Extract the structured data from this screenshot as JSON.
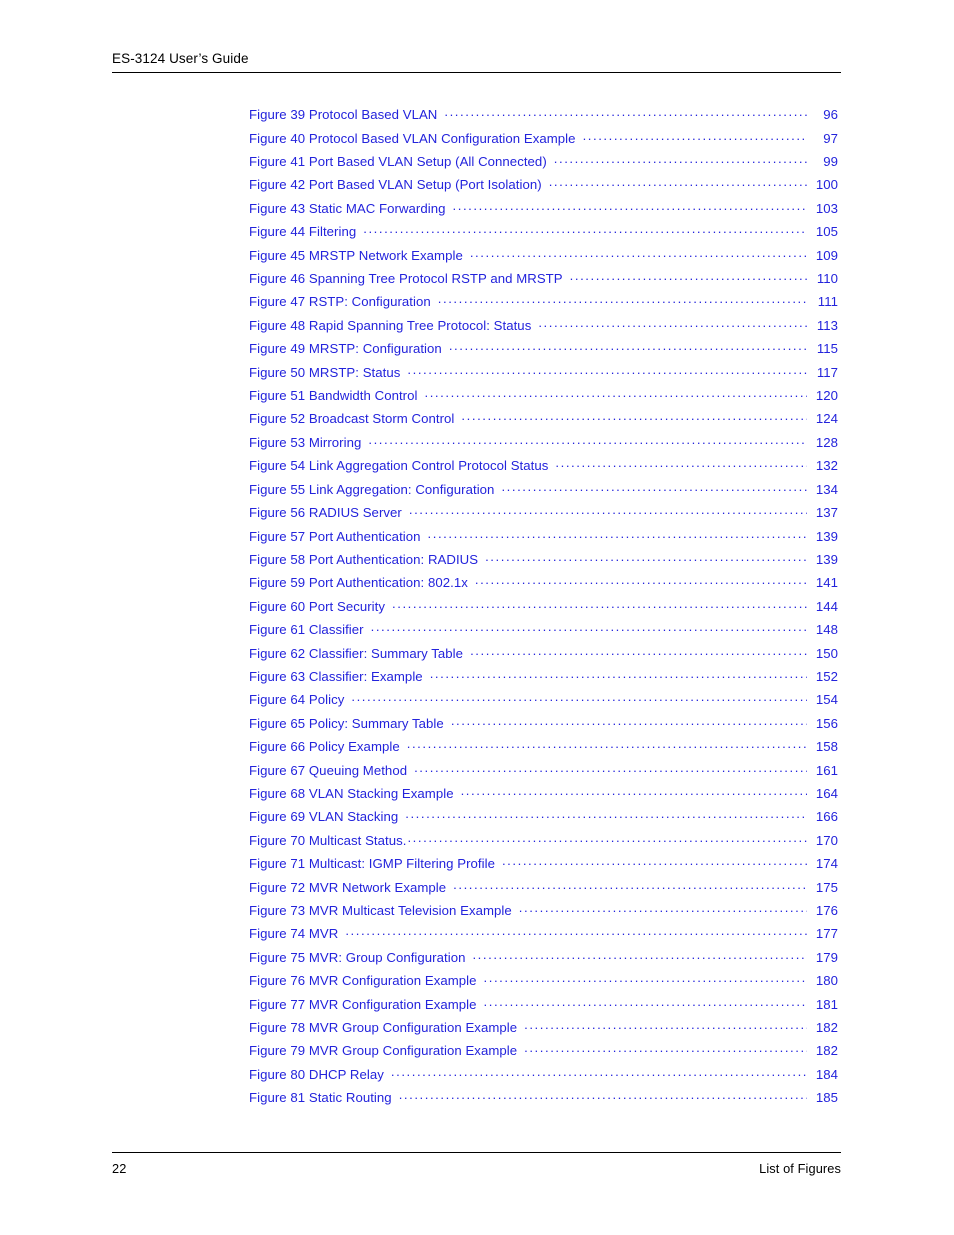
{
  "document": {
    "header_title": "ES-3124 User’s Guide",
    "footer_page_number": "22",
    "footer_section": "List of Figures",
    "link_color": "#2323DC",
    "text_color": "#000000",
    "background_color": "#FFFFFF"
  },
  "figure_list": {
    "entries": [
      {
        "title": "Figure 39 Protocol Based VLAN",
        "page": "96"
      },
      {
        "title": "Figure 40 Protocol Based VLAN Configuration Example",
        "page": "97"
      },
      {
        "title": "Figure 41 Port Based VLAN Setup (All Connected)",
        "page": "99"
      },
      {
        "title": "Figure 42 Port Based VLAN Setup (Port Isolation)",
        "page": "100"
      },
      {
        "title": "Figure 43 Static MAC Forwarding",
        "page": "103"
      },
      {
        "title": "Figure 44 Filtering",
        "page": "105"
      },
      {
        "title": "Figure 45 MRSTP Network Example",
        "page": "109"
      },
      {
        "title": "Figure 46 Spanning Tree Protocol RSTP and MRSTP",
        "page": "110"
      },
      {
        "title": "Figure 47 RSTP: Configuration",
        "page": "111"
      },
      {
        "title": "Figure 48 Rapid Spanning Tree Protocol: Status",
        "page": "113"
      },
      {
        "title": "Figure 49 MRSTP: Configuration",
        "page": "115"
      },
      {
        "title": "Figure 50 MRSTP: Status",
        "page": "117"
      },
      {
        "title": "Figure 51 Bandwidth Control",
        "page": "120"
      },
      {
        "title": "Figure 52 Broadcast Storm Control",
        "page": "124"
      },
      {
        "title": "Figure 53 Mirroring",
        "page": "128"
      },
      {
        "title": "Figure 54 Link Aggregation Control Protocol Status",
        "page": "132"
      },
      {
        "title": "Figure 55 Link Aggregation: Configuration",
        "page": "134"
      },
      {
        "title": "Figure 56 RADIUS Server",
        "page": "137"
      },
      {
        "title": "Figure 57 Port Authentication",
        "page": "139"
      },
      {
        "title": "Figure 58 Port Authentication: RADIUS",
        "page": "139"
      },
      {
        "title": "Figure 59 Port Authentication: 802.1x",
        "page": "141"
      },
      {
        "title": "Figure 60 Port Security",
        "page": "144"
      },
      {
        "title": "Figure 61 Classifier",
        "page": "148"
      },
      {
        "title": "Figure 62 Classifier: Summary Table",
        "page": "150"
      },
      {
        "title": "Figure 63 Classifier: Example",
        "page": "152"
      },
      {
        "title": "Figure 64 Policy",
        "page": "154"
      },
      {
        "title": "Figure 65 Policy: Summary Table",
        "page": "156"
      },
      {
        "title": "Figure 66 Policy Example",
        "page": "158"
      },
      {
        "title": "Figure 67 Queuing Method",
        "page": "161"
      },
      {
        "title": "Figure 68 VLAN Stacking Example",
        "page": "164"
      },
      {
        "title": "Figure 69 VLAN Stacking",
        "page": "166"
      },
      {
        "title": "Figure 70 Multicast Status.",
        "page": "170"
      },
      {
        "title": "Figure 71 Multicast: IGMP Filtering Profile",
        "page": "174"
      },
      {
        "title": "Figure 72 MVR Network Example",
        "page": "175"
      },
      {
        "title": "Figure 73 MVR Multicast Television Example",
        "page": "176"
      },
      {
        "title": "Figure 74 MVR",
        "page": "177"
      },
      {
        "title": "Figure 75 MVR: Group Configuration",
        "page": "179"
      },
      {
        "title": "Figure 76 MVR Configuration Example",
        "page": "180"
      },
      {
        "title": "Figure 77 MVR Configuration Example",
        "page": "181"
      },
      {
        "title": "Figure 78 MVR Group Configuration Example",
        "page": "182"
      },
      {
        "title": "Figure 79 MVR Group Configuration Example",
        "page": "182"
      },
      {
        "title": "Figure 80 DHCP Relay",
        "page": "184"
      },
      {
        "title": "Figure 81 Static Routing",
        "page": "185"
      }
    ]
  }
}
